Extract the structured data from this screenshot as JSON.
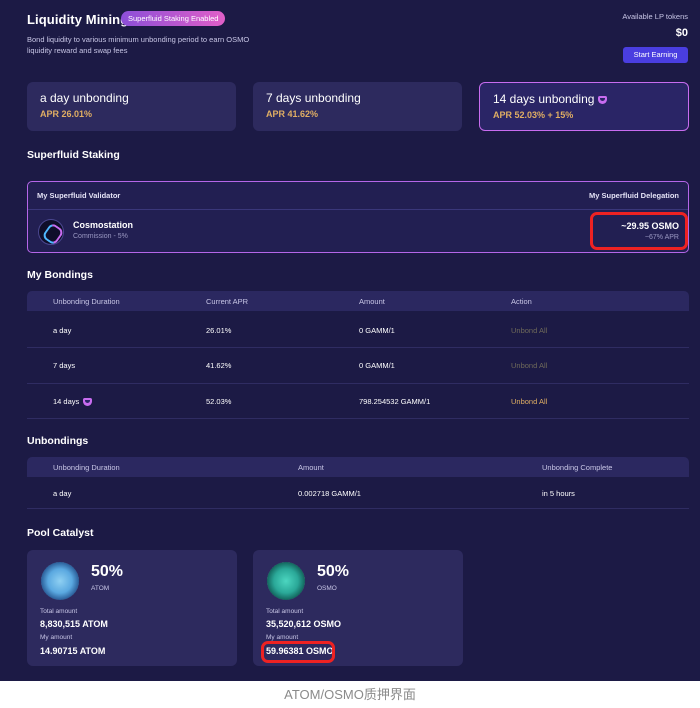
{
  "header": {
    "title": "Liquidity Mining",
    "badge": "Superfluid Staking Enabled",
    "description": "Bond liquidity to various minimum unbonding period to earn OSMO liquidity reward and swap fees",
    "lp_label": "Available LP tokens",
    "lp_value": "$0",
    "start_button": "Start Earning"
  },
  "unbonding_cards": [
    {
      "title": "a day unbonding",
      "apr": "APR 26.01%",
      "selected": false
    },
    {
      "title": "7 days unbonding",
      "apr": "APR 41.62%",
      "selected": false
    },
    {
      "title": "14 days unbonding",
      "apr": "APR 52.03% + 15%",
      "selected": true
    }
  ],
  "superfluid": {
    "section_title": "Superfluid Staking",
    "validator_header": "My Superfluid Validator",
    "delegation_header": "My Superfluid Delegation",
    "validator_name": "Cosmostation",
    "commission": "Commission - 5%",
    "delegation_amount": "~29.95 OSMO",
    "delegation_apr": "~67% APR"
  },
  "bondings": {
    "section_title": "My Bondings",
    "columns": [
      "Unbonding Duration",
      "Current APR",
      "Amount",
      "Action"
    ],
    "rows": [
      {
        "duration": "a day",
        "apr": "26.01%",
        "amount": "0 GAMM/1",
        "action": "Unbond All",
        "active": false
      },
      {
        "duration": "7 days",
        "apr": "41.62%",
        "amount": "0 GAMM/1",
        "action": "Unbond All",
        "active": false
      },
      {
        "duration": "14 days",
        "apr": "52.03%",
        "amount": "798.254532 GAMM/1",
        "action": "Unbond All",
        "active": true
      }
    ]
  },
  "unbondings": {
    "section_title": "Unbondings",
    "columns": [
      "Unbonding Duration",
      "Amount",
      "Unbonding Complete"
    ],
    "rows": [
      {
        "duration": "a day",
        "amount": "0.002718 GAMM/1",
        "complete": "in 5 hours"
      }
    ]
  },
  "pool_catalyst": {
    "section_title": "Pool Catalyst",
    "cards": [
      {
        "percent": "50%",
        "symbol": "ATOM",
        "total_label": "Total amount",
        "total": "8,830,515 ATOM",
        "my_label": "My amount",
        "my": "14.90715 ATOM",
        "icon": "atom-token-icon"
      },
      {
        "percent": "50%",
        "symbol": "OSMO",
        "total_label": "Total amount",
        "total": "35,520,612 OSMO",
        "my_label": "My amount",
        "my": "59.96381 OSMO",
        "icon": "osmo-token-icon"
      }
    ]
  },
  "caption": "ATOM/OSMO质押界面",
  "colors": {
    "background": "#1c1a45",
    "card": "#2d2a5e",
    "accent_gold": "#e0ae63",
    "accent_purple": "#c86cf0",
    "button": "#4a3ee0",
    "highlight_red": "#ee2222"
  }
}
